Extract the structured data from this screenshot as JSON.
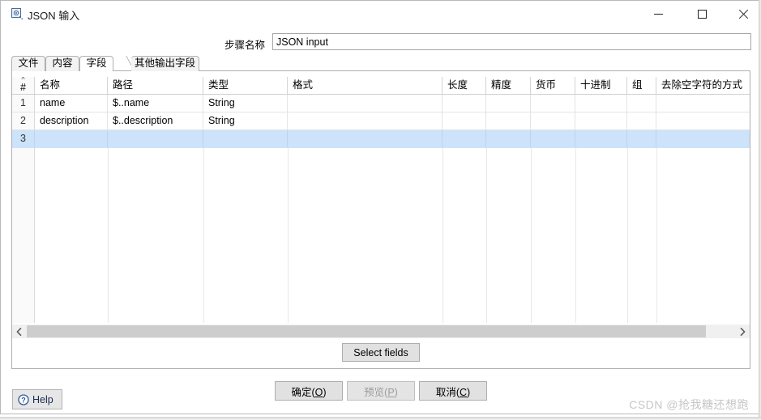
{
  "window": {
    "title": "JSON 输入",
    "icon": "json-input-step-icon",
    "controls": {
      "minimize": "minimize-icon",
      "maximize": "maximize-icon",
      "close": "close-icon"
    }
  },
  "step_name": {
    "label": "步骤名称",
    "value": "JSON input",
    "placeholder": ""
  },
  "tabs": [
    {
      "label": "文件",
      "selected": false
    },
    {
      "label": "内容",
      "selected": false
    },
    {
      "label": "字段",
      "selected": true
    },
    {
      "label": "其他输出字段",
      "selected": false
    }
  ],
  "table": {
    "columns": [
      {
        "key": "num",
        "label": "#",
        "sorted": true
      },
      {
        "key": "name",
        "label": "名称"
      },
      {
        "key": "path",
        "label": "路径"
      },
      {
        "key": "type",
        "label": "类型"
      },
      {
        "key": "format",
        "label": "格式"
      },
      {
        "key": "length",
        "label": "长度"
      },
      {
        "key": "precision",
        "label": "精度"
      },
      {
        "key": "currency",
        "label": "货币"
      },
      {
        "key": "decimal",
        "label": "十进制"
      },
      {
        "key": "group",
        "label": "组"
      },
      {
        "key": "trim",
        "label": "去除空字符的方式"
      }
    ],
    "rows": [
      {
        "num": "1",
        "name": "name",
        "path": "$..name",
        "type": "String",
        "format": "",
        "length": "",
        "precision": "",
        "currency": "",
        "decimal": "",
        "group": "",
        "trim": "",
        "selected": false
      },
      {
        "num": "2",
        "name": "description",
        "path": "$..description",
        "type": "String",
        "format": "",
        "length": "",
        "precision": "",
        "currency": "",
        "decimal": "",
        "group": "",
        "trim": "",
        "selected": false
      },
      {
        "num": "3",
        "name": "",
        "path": "",
        "type": "",
        "format": "",
        "length": "",
        "precision": "",
        "currency": "",
        "decimal": "",
        "group": "",
        "trim": "",
        "selected": true
      }
    ]
  },
  "scrollbar": {
    "left_arrow": "chevron-left-icon",
    "right_arrow": "chevron-right-icon"
  },
  "select_fields_button": {
    "label": "Select fields"
  },
  "footer": {
    "ok": {
      "label": "确定(O)",
      "mnemonic": "O",
      "disabled": false
    },
    "preview": {
      "label": "预览(P)",
      "mnemonic": "P",
      "disabled": true
    },
    "cancel": {
      "label": "取消(C)",
      "mnemonic": "C",
      "disabled": false
    }
  },
  "help": {
    "label": "Help",
    "icon": "question-circle-icon"
  },
  "watermark": {
    "text": "CSDN @抢我糖还想跑"
  },
  "colors": {
    "selection_row": "#cce3fa",
    "window_border": "#b9b9b9",
    "button_face": "#e1e1e1",
    "help_text": "#1a2b4d",
    "watermark": "#c6c6c6"
  }
}
